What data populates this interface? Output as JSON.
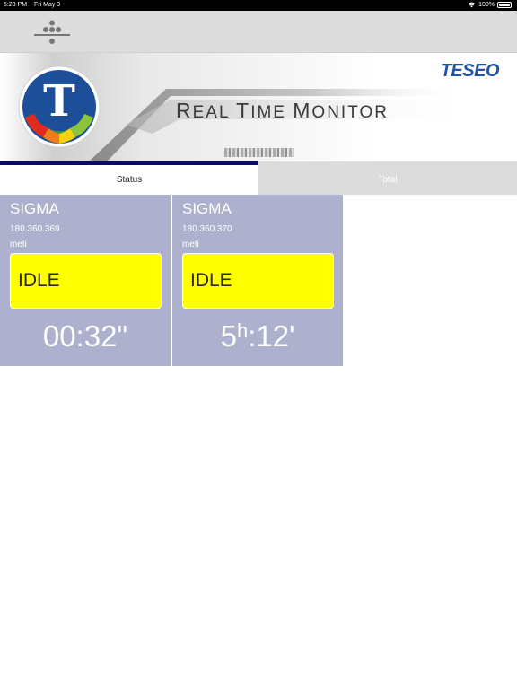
{
  "status_bar": {
    "time": "5:23 PM",
    "date": "Fri May 3",
    "battery": "100%"
  },
  "toolbar": {
    "menu_icon": "dots-divider-icon"
  },
  "banner": {
    "title_parts": [
      {
        "cap": "R",
        "rest": "EAL "
      },
      {
        "cap": "T",
        "rest": "IME "
      },
      {
        "cap": "M",
        "rest": "ONITOR"
      }
    ],
    "brand": "TESEO",
    "logo_letter": "T"
  },
  "tabs": [
    {
      "label": "Status",
      "active": true
    },
    {
      "label": "Total",
      "active": false
    }
  ],
  "cards": [
    {
      "name": "SIGMA",
      "code": "180.360.369",
      "user": "meti",
      "state": "IDLE",
      "time_main": "00:32\"",
      "state_color": "#ffff00"
    },
    {
      "name": "SIGMA",
      "code": "180.360.370",
      "user": "meti",
      "state": "IDLE",
      "time_h": "5",
      "time_h_unit": "h",
      "time_rest": ":12'",
      "state_color": "#ffff00"
    }
  ],
  "colors": {
    "card_bg": "#adb1cd",
    "tab_accent": "#0a0a6e",
    "brand": "#1f55a2"
  }
}
